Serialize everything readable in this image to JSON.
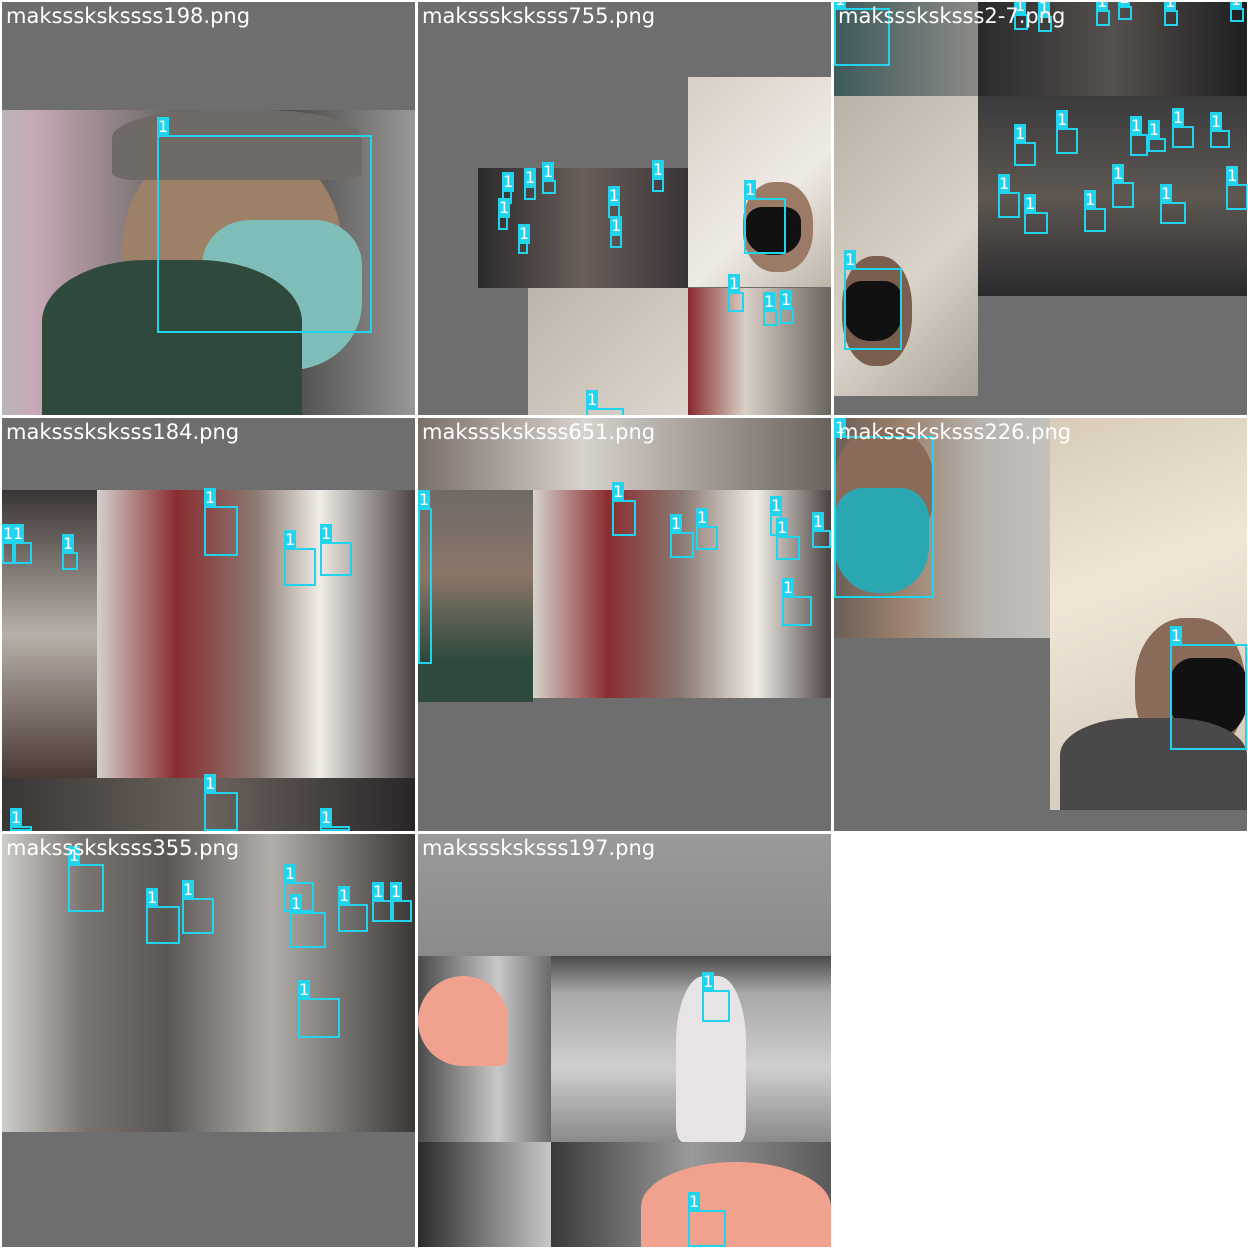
{
  "grid": {
    "tiles": [
      {
        "filename": "makssskskssss198.png",
        "box_label": "1"
      },
      {
        "filename": "maksssksksss755.png",
        "box_label": "1"
      },
      {
        "filename": "maksssksksss2-7.png",
        "box_label": "1"
      },
      {
        "filename": "maksssksksss184.png",
        "box_label": "1"
      },
      {
        "filename": "maksssksksss651.png",
        "box_label": "1"
      },
      {
        "filename": "maksssksksss226.png",
        "box_label": "1"
      },
      {
        "filename": "maksssksksss355.png",
        "box_label": "1"
      },
      {
        "filename": "maksssksksss197.png",
        "box_label": "1"
      }
    ]
  },
  "colors": {
    "box": "#22d3ee",
    "padding": "#6e6e6e",
    "label_text": "#ffffff"
  },
  "class_label": "1"
}
